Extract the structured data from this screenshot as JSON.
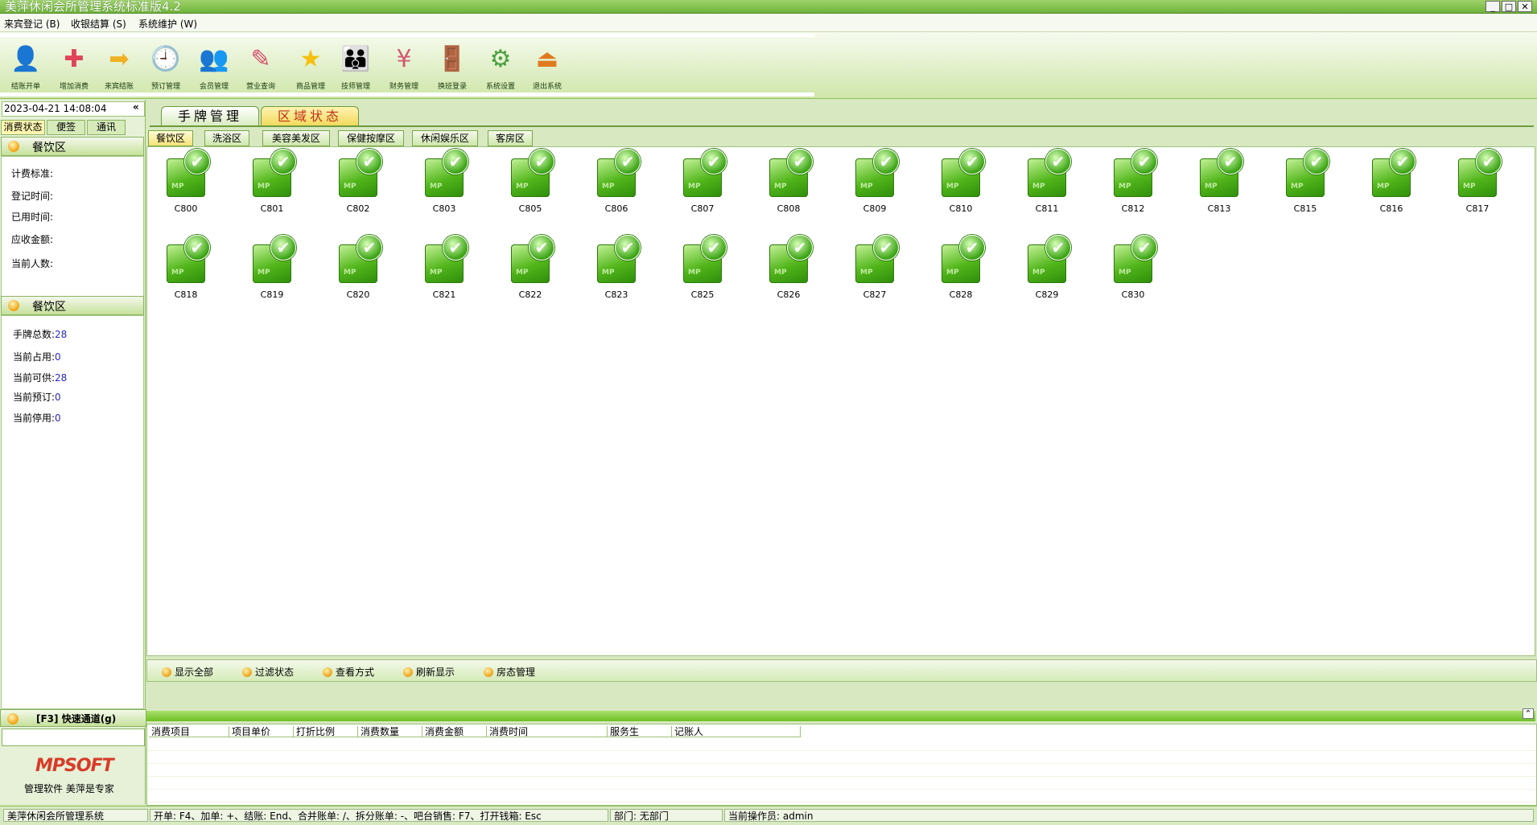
{
  "window": {
    "title": "美萍休闲会所管理系统标准版4.2",
    "buttons": {
      "minimize": "_",
      "maximize": "□",
      "close": "✕"
    }
  },
  "menu": [
    "来宾登记 (B)",
    "收银结算 (S)",
    "系统维护 (W)"
  ],
  "toolbar": [
    {
      "label": "结账开单",
      "icon": "person-icon"
    },
    {
      "label": "增加消费",
      "icon": "add-consumption-icon"
    },
    {
      "label": "来宾结账",
      "icon": "checkout-arrow-icon"
    },
    {
      "label": "预订管理",
      "icon": "clock-icon"
    },
    {
      "label": "会员管理",
      "icon": "members-icon"
    },
    {
      "label": "营业查询",
      "icon": "query-icon"
    },
    {
      "label": "商品管理",
      "icon": "star-icon"
    },
    {
      "label": "技师管理",
      "icon": "staff-icon"
    },
    {
      "label": "财务管理",
      "icon": "finance-icon"
    },
    {
      "label": "换班登录",
      "icon": "door-icon"
    },
    {
      "label": "系统设置",
      "icon": "gears-icon"
    },
    {
      "label": "退出系统",
      "icon": "exit-icon"
    }
  ],
  "left": {
    "datetime": "2023-04-21 14:08:04",
    "collapse": "«",
    "tabs": [
      "消费状态",
      "便签",
      "通讯"
    ],
    "section1": {
      "title": "餐饮区",
      "fields": [
        "计费标准:",
        "登记时间:",
        "已用时间:",
        "应收金额:",
        "当前人数:"
      ]
    },
    "section2": {
      "title": "餐饮区",
      "stats": [
        {
          "label": "手牌总数:",
          "value": "28"
        },
        {
          "label": "当前占用:",
          "value": "0"
        },
        {
          "label": "当前可供:",
          "value": "28"
        },
        {
          "label": "当前预订:",
          "value": "0"
        },
        {
          "label": "当前停用:",
          "value": "0"
        }
      ]
    },
    "quick": {
      "title": "[F3] 快速通道(g)",
      "logo": "MPSOFT",
      "slogan": "管理软件 美萍是专家"
    }
  },
  "main": {
    "tabs": [
      "手牌管理",
      "区域状态"
    ],
    "zones": [
      "餐饮区",
      "洗浴区",
      "美容美发区",
      "保健按摩区",
      "休闲娱乐区",
      "客房区"
    ],
    "rooms": [
      "C800",
      "C801",
      "C802",
      "C803",
      "C805",
      "C806",
      "C807",
      "C808",
      "C809",
      "C810",
      "C811",
      "C812",
      "C813",
      "C815",
      "C816",
      "C817",
      "C818",
      "C819",
      "C820",
      "C821",
      "C822",
      "C823",
      "C825",
      "C826",
      "C827",
      "C828",
      "C829",
      "C830"
    ],
    "actions": [
      "显示全部",
      "过滤状态",
      "查看方式",
      "刷新显示",
      "房态管理"
    ],
    "table_columns": [
      "消费项目",
      "项目单价",
      "打折比例",
      "消费数量",
      "消费金额",
      "消费时间",
      "服务生",
      "记账人"
    ],
    "scroll_up": "⌃"
  },
  "status": [
    "美萍休闲会所管理系统",
    "开单: F4、加单: +、结账: End、合并账单: /、拆分账单: -、吧台销售: F7、打开钱箱: Esc",
    "部门: 无部门",
    "当前操作员: admin"
  ],
  "colors": {
    "accent_green": "#6fb33a",
    "link_blue": "#2a28c8",
    "active_tab": "#f6e37a"
  }
}
